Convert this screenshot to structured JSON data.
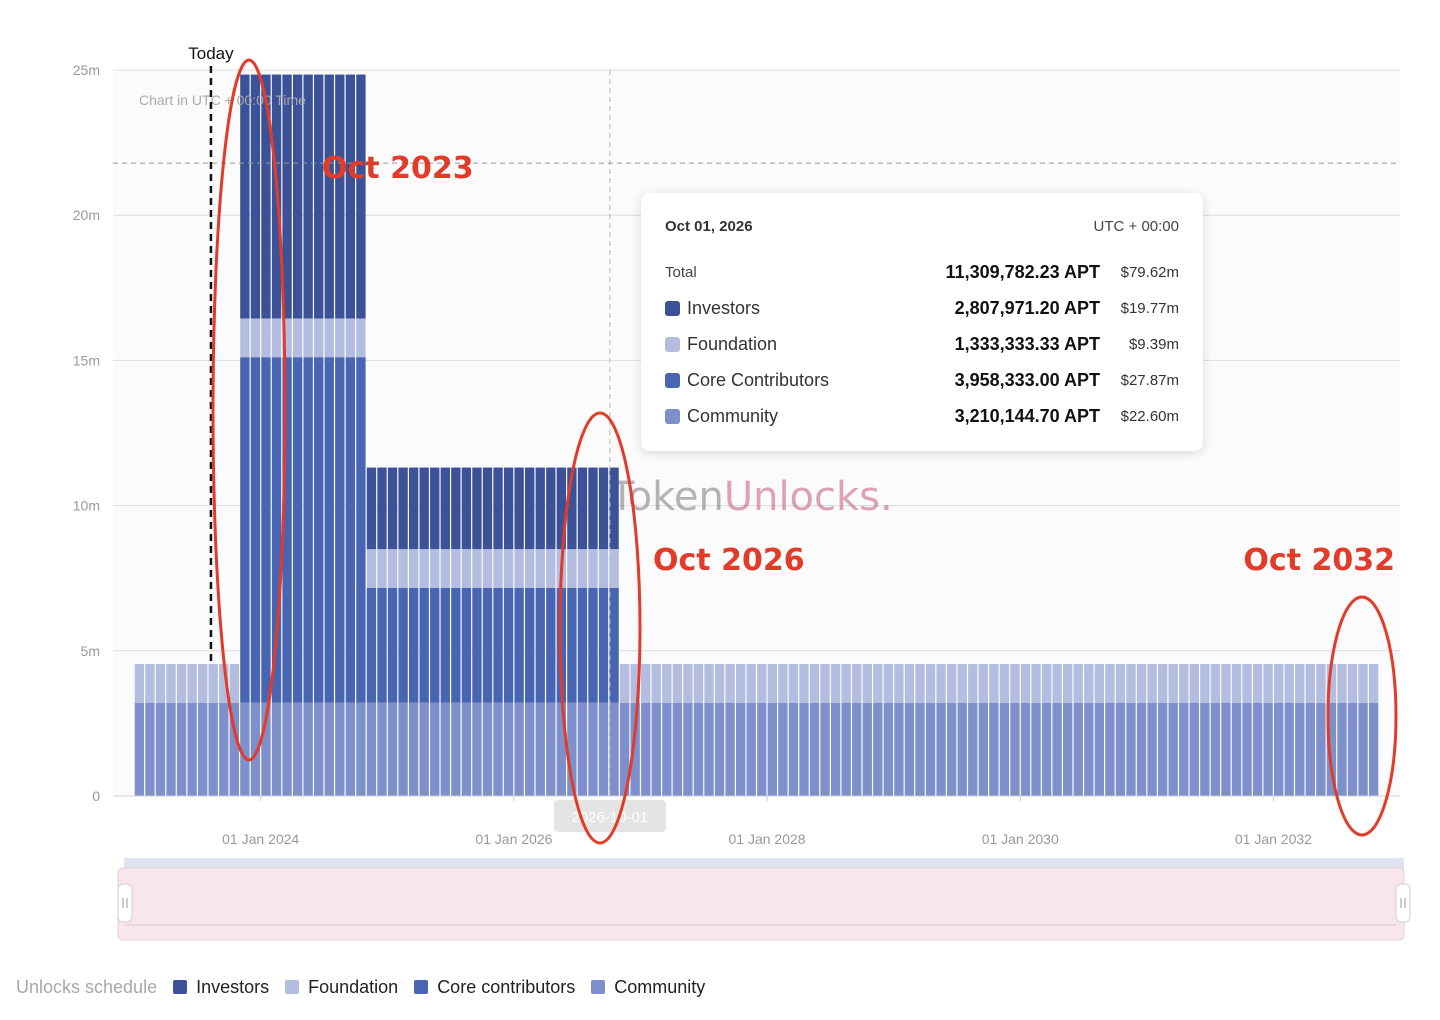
{
  "chart_data": {
    "type": "bar",
    "stacked": true,
    "subtitle": "Chart in UTC + 00:00 Time",
    "watermark": "TokenUnlocks.",
    "ylim": [
      0,
      25000000
    ],
    "y_ticks": [
      "0",
      "5m",
      "10m",
      "15m",
      "20m",
      "25m"
    ],
    "x_ticks": [
      "01 Jan 2024",
      "01 Jan 2026",
      "01 Jan 2028",
      "01 Jan 2030",
      "01 Jan 2032"
    ],
    "x_start": "2023-01",
    "x_end": "2032-10",
    "today_label": "Today",
    "today": "2023-08",
    "hover_date": "2026-10-01",
    "series": [
      {
        "name": "Investors",
        "color": "#3b5298",
        "segments": [
          {
            "from": "2023-11",
            "to": "2024-10",
            "value": 8400000
          },
          {
            "from": "2024-11",
            "to": "2026-10",
            "value": 2807971.2
          }
        ]
      },
      {
        "name": "Foundation",
        "color": "#b3bde0",
        "segments": [
          {
            "from": "2023-01",
            "to": "2032-10",
            "value": 1333333.33
          }
        ]
      },
      {
        "name": "Core contributors",
        "color": "#4765b3",
        "segments": [
          {
            "from": "2023-11",
            "to": "2024-10",
            "value": 11900000
          },
          {
            "from": "2024-11",
            "to": "2026-10",
            "value": 3958333
          }
        ]
      },
      {
        "name": "Community",
        "color": "#7d90cb",
        "segments": [
          {
            "from": "2023-01",
            "to": "2032-10",
            "value": 3210144.7
          }
        ]
      }
    ],
    "annotations": [
      "Oct 2023",
      "Oct 2026",
      "Oct 2032"
    ],
    "legend_title": "Unlocks schedule",
    "legend_position": "bottom-left",
    "grid": true
  },
  "tooltip": {
    "date": "Oct 01, 2026",
    "tz": "UTC + 00:00",
    "total": {
      "label": "Total",
      "amount": "11,309,782.23 APT",
      "usd": "$79.62m"
    },
    "rows": [
      {
        "label": "Investors",
        "amount": "2,807,971.20 APT",
        "usd": "$19.77m",
        "color": "#3b5298"
      },
      {
        "label": "Foundation",
        "amount": "1,333,333.33 APT",
        "usd": "$9.39m",
        "color": "#b3bde0"
      },
      {
        "label": "Core Contributors",
        "amount": "3,958,333.00 APT",
        "usd": "$27.87m",
        "color": "#4765b3"
      },
      {
        "label": "Community",
        "amount": "3,210,144.70 APT",
        "usd": "$22.60m",
        "color": "#7d90cb"
      }
    ]
  }
}
